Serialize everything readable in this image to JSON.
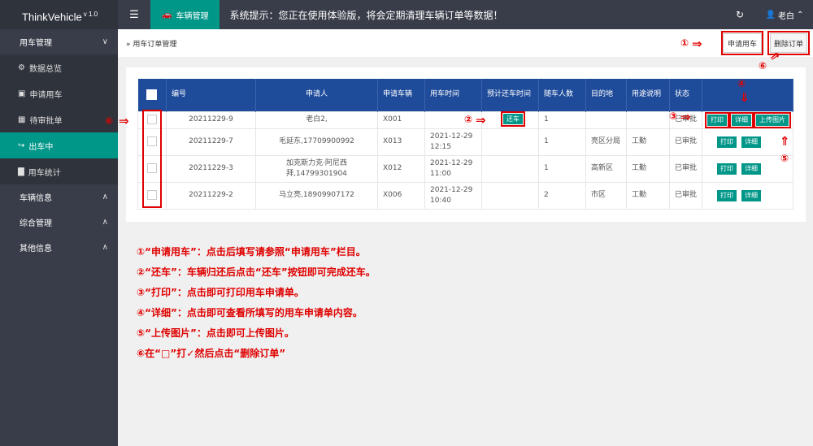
{
  "topbar": {
    "brand": "ThinkVehicle",
    "version": "v 1.0",
    "menu_icon": "☰",
    "tab_label": "车辆管理",
    "notice": "系统提示：您正在使用体验版，将会定期清理车辆订单等数据！",
    "refresh_icon": "↻",
    "user_name": "老白",
    "user_icon": "⌂"
  },
  "sidebar": {
    "groups": [
      {
        "label": "用车管理",
        "expanded": true
      },
      {
        "label": "车辆信息"
      },
      {
        "label": "综合管理"
      },
      {
        "label": "其他信息"
      }
    ],
    "items": [
      {
        "label": "数据总览",
        "icon": "⚙"
      },
      {
        "label": "申请用车",
        "icon": "▣"
      },
      {
        "label": "待审批单",
        "icon": "▦"
      },
      {
        "label": "出车中",
        "icon": "↪"
      },
      {
        "label": "用车统计",
        "icon": "▇"
      }
    ]
  },
  "header": {
    "breadcrumb_sep": "»",
    "breadcrumb": "用车订单管理",
    "apply_button": "申请用车",
    "delete_button": "删除订单"
  },
  "table": {
    "columns": [
      "编号",
      "申请人",
      "申请车辆",
      "用车时间",
      "预计还车时间",
      "随车人数",
      "目的地",
      "用途说明",
      "状态"
    ],
    "rows": [
      {
        "id": "20211229-9",
        "applicant": "老白2,",
        "vehicle": "X001",
        "time": "",
        "return_label": "还车",
        "people": "1",
        "dest": "",
        "purpose": "",
        "status": "已审批",
        "ops": [
          "打印",
          "详细",
          "上传图片"
        ]
      },
      {
        "id": "20211229-7",
        "applicant": "毛延东,17709900992",
        "vehicle": "X013",
        "time": "2021-12-29 12:15",
        "people": "1",
        "dest": "亮区分局",
        "purpose": "工勤",
        "status": "已审批",
        "ops": [
          "打印",
          "详细"
        ]
      },
      {
        "id": "20211229-3",
        "applicant": "加克斯力克·阿尼西拜,14799301904",
        "vehicle": "X012",
        "time": "2021-12-29 11:00",
        "people": "1",
        "dest": "高新区",
        "purpose": "工勤",
        "status": "已审批",
        "ops": [
          "打印",
          "详细"
        ]
      },
      {
        "id": "20211229-2",
        "applicant": "马立亮,18909907172",
        "vehicle": "X006",
        "time": "2021-12-29 10:40",
        "people": "2",
        "dest": "市区",
        "purpose": "工勤",
        "status": "已审批",
        "ops": [
          "打印",
          "详细"
        ]
      }
    ]
  },
  "annotations": {
    "m1": "①",
    "m2": "②",
    "m3": "③",
    "m4": "④",
    "m5": "⑤",
    "m6": "⑥"
  },
  "instructions": [
    "①“申请用车”：点击后填写请参照“申请用车”栏目。",
    "②“还车”：车辆归还后点击“还车”按钮即可完成还车。",
    "③“打印”：点击即可打印用车申请单。",
    "④“详细”：点击即可查看所填写的用车申请单内容。",
    "⑤“上传图片”：点击即可上传图片。",
    "⑥在“□”打✓然后点击“删除订单”"
  ],
  "colors": {
    "topbar": "#393d49",
    "accent": "#009688",
    "table_header": "#1e4b9a",
    "annotation": "#e00000"
  }
}
